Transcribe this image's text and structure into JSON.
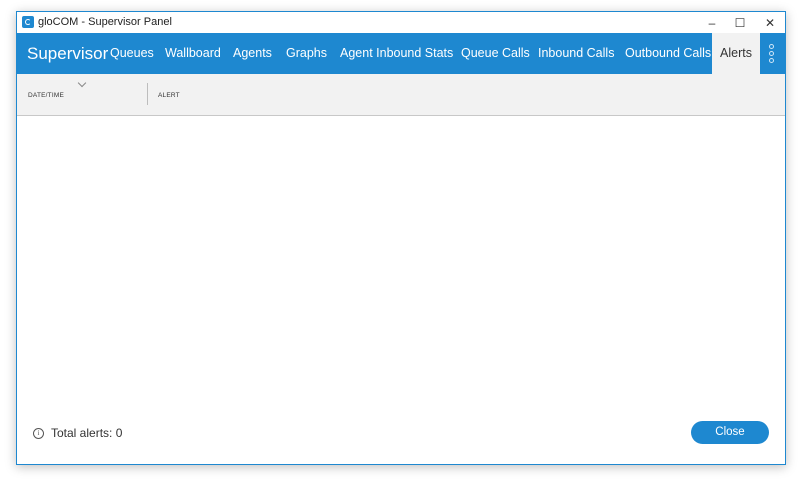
{
  "window": {
    "title": "gloCOM - Supervisor Panel",
    "minimize_glyph": "–",
    "maximize_glyph": "☐",
    "close_glyph": "✕"
  },
  "nav": {
    "brand": "Supervisor",
    "tabs": [
      {
        "label": "Queues"
      },
      {
        "label": "Wallboard"
      },
      {
        "label": "Agents"
      },
      {
        "label": "Graphs"
      },
      {
        "label": "Agent Inbound Stats"
      },
      {
        "label": "Queue Calls"
      },
      {
        "label": "Inbound Calls"
      },
      {
        "label": "Outbound Calls"
      },
      {
        "label": "Alerts",
        "active": true
      }
    ],
    "more_icon": "more-options-icon",
    "accent_color": "#1e88d0"
  },
  "table": {
    "columns": [
      {
        "label": "DATE/TIME"
      },
      {
        "label": "ALERT"
      }
    ],
    "rows": []
  },
  "footer": {
    "total_label": "Total alerts: 0",
    "close_label": "Close"
  }
}
